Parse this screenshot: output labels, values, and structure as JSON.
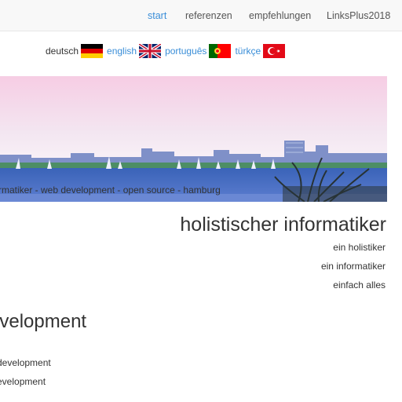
{
  "nav": {
    "items": [
      {
        "label": "start",
        "active": true
      },
      {
        "label": "referenzen",
        "active": false
      },
      {
        "label": "empfehlungen",
        "active": false
      },
      {
        "label": "LinksPlus2018",
        "active": false
      }
    ]
  },
  "languages": [
    {
      "label": "deutsch",
      "flag": "germany-flag-icon",
      "current": true
    },
    {
      "label": "english",
      "flag": "uk-flag-icon",
      "current": false
    },
    {
      "label": "português",
      "flag": "portugal-flag-icon",
      "current": false
    },
    {
      "label": "türkçe",
      "flag": "turkey-flag-icon",
      "current": false
    }
  ],
  "banner": {
    "tagline": "rmatiker - web development - open source - hamburg"
  },
  "section1": {
    "heading": "holistischer informatiker",
    "lines": [
      "ein holistiker",
      "ein informatiker",
      "einfach alles"
    ]
  },
  "section2": {
    "heading": "evelopment",
    "lines": [
      "development",
      "evelopment"
    ]
  },
  "colors": {
    "link": "#3a8ed8",
    "text": "#333333",
    "navbar_bg": "#f8f8f8"
  }
}
